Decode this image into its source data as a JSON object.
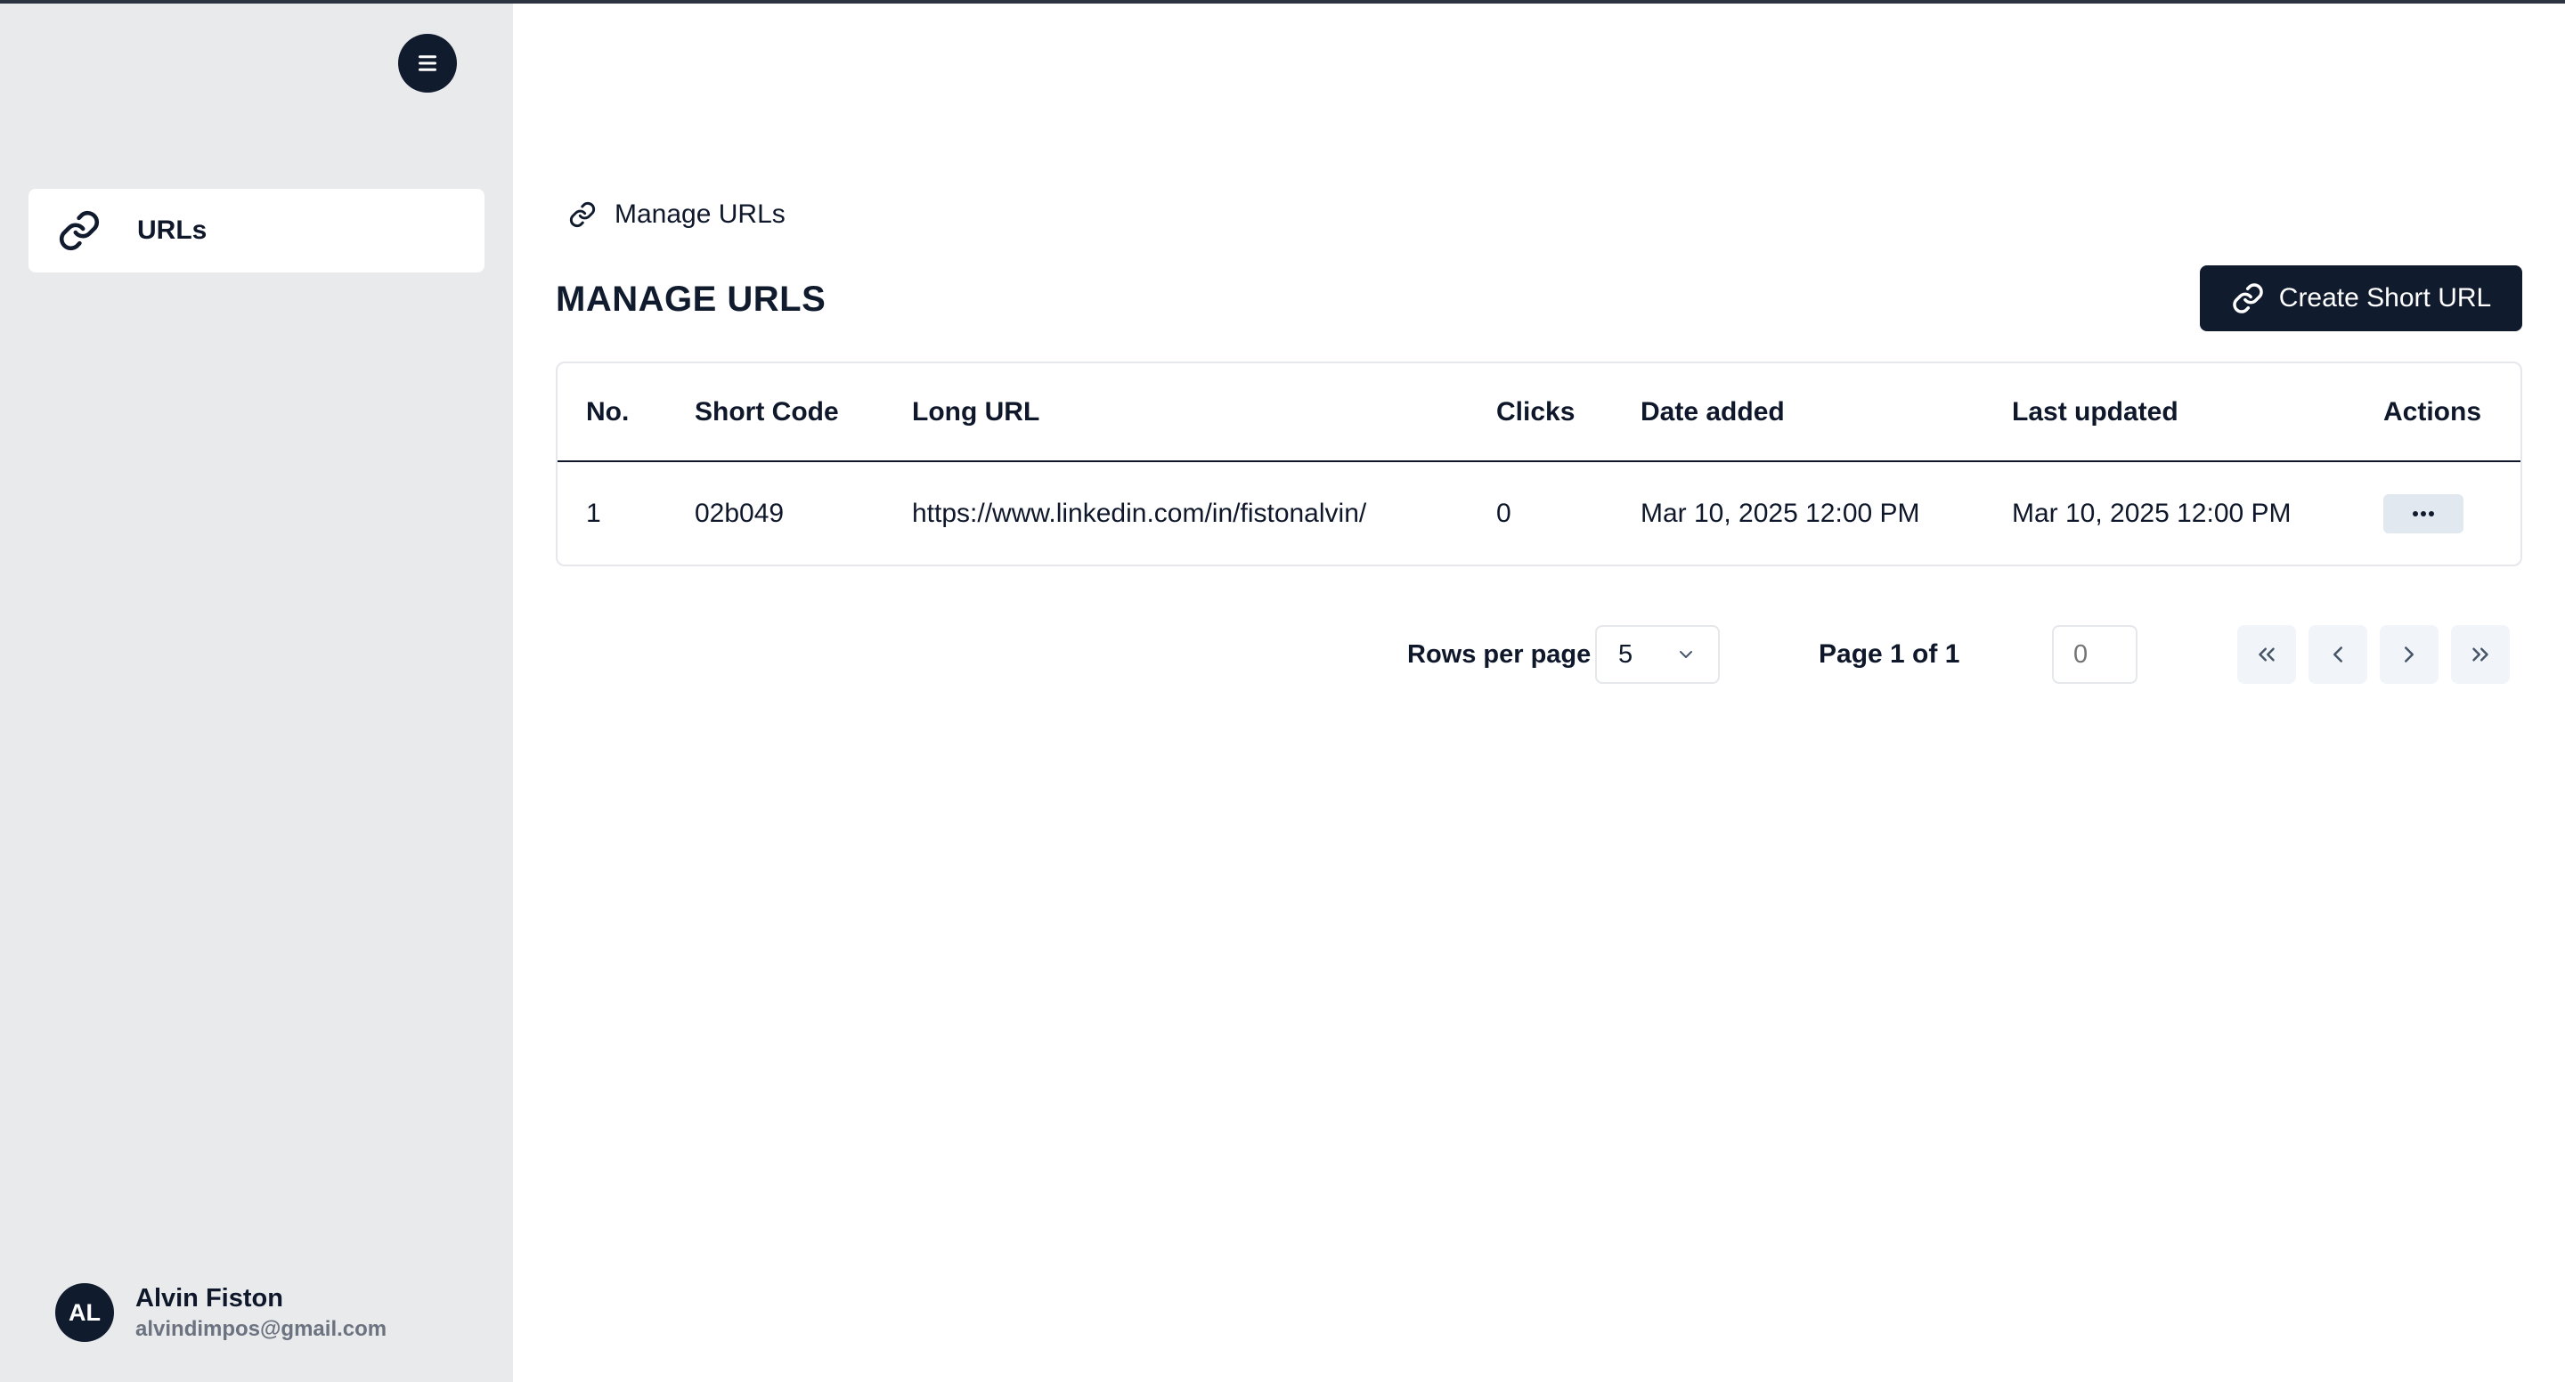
{
  "sidebar": {
    "nav_items": [
      {
        "label": "URLs",
        "icon": "link-icon"
      }
    ],
    "user": {
      "initials": "AL",
      "name": "Alvin Fiston",
      "email": "alvindimpos@gmail.com"
    }
  },
  "breadcrumb": {
    "label": "Manage URLs",
    "icon": "link-icon"
  },
  "page": {
    "title": "MANAGE URLS",
    "create_button": "Create Short URL"
  },
  "table": {
    "headers": [
      "No.",
      "Short Code",
      "Long URL",
      "Clicks",
      "Date added",
      "Last updated",
      "Actions"
    ],
    "rows": [
      {
        "no": "1",
        "short_code": "02b049",
        "long_url": "https://www.linkedin.com/in/fistonalvin/",
        "clicks": "0",
        "date_added": "Mar 10, 2025 12:00 PM",
        "last_updated": "Mar 10, 2025 12:00 PM"
      }
    ]
  },
  "pagination": {
    "rows_per_page_label": "Rows per page",
    "rows_per_page_value": "5",
    "page_info": "Page 1 of 1",
    "page_input_placeholder": "0"
  },
  "colors": {
    "primary": "#111b2e",
    "sidebar_bg": "#e9eaeb",
    "muted_button": "#e2e8f0"
  }
}
